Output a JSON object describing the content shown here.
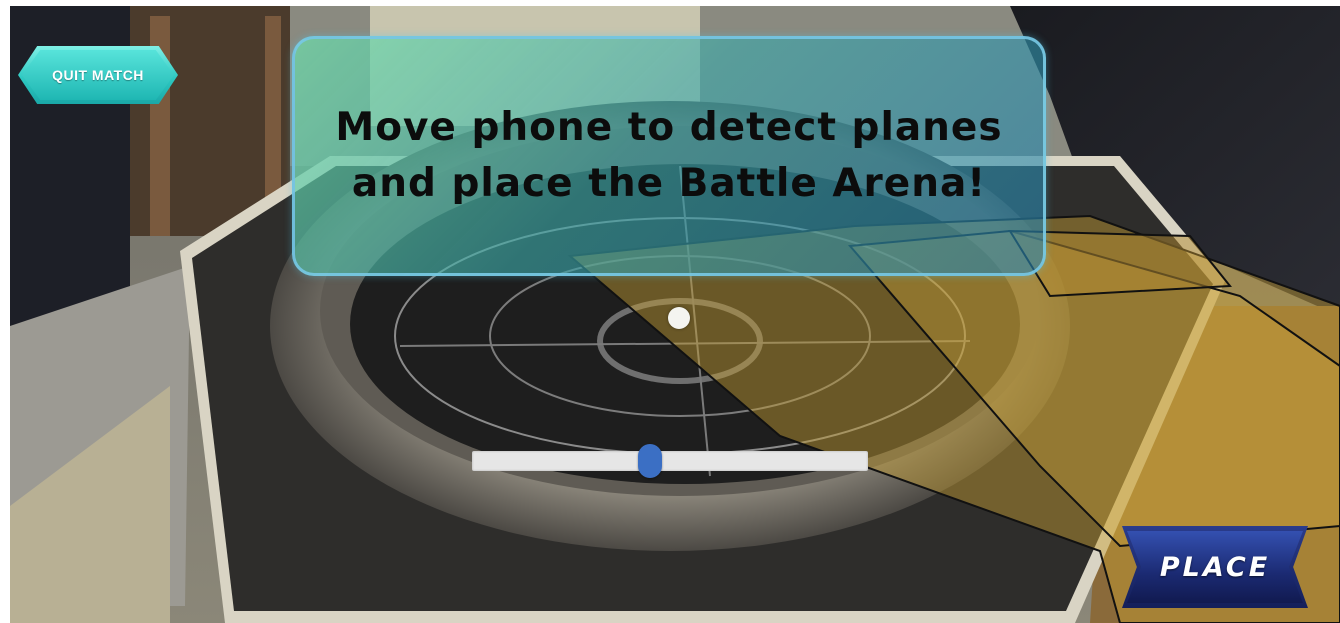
{
  "hud": {
    "quit_label": "QUIT MATCH",
    "instruction": "Move phone to detect planes and place the Battle Arena!",
    "place_label": "PLACE"
  },
  "scale_slider": {
    "value": 0.45
  },
  "colors": {
    "panel_tint": "#4fc6a8",
    "slider_handle": "#3b6fc4",
    "quit_button": "#2ec9c2",
    "place_button": "#1b2a72"
  }
}
